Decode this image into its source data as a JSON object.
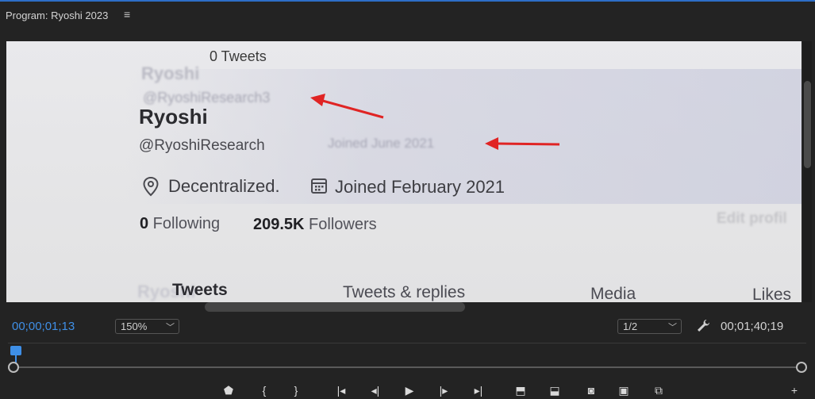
{
  "panel": {
    "title": "Program: Ryoshi 2023",
    "menu_icon": "hamburger-icon"
  },
  "video": {
    "tweets_count": "0 Tweets",
    "ghost_name": "Ryoshi",
    "ghost_handle": "@RyoshiResearch3",
    "name": "Ryoshi",
    "handle": "@RyoshiResearch",
    "ghost_joined": "Joined June 2021",
    "location": "Decentralized.",
    "joined": "Joined February 2021",
    "following_count": "0",
    "following_label": " Following",
    "followers_count": "209.5K",
    "followers_label": " Followers",
    "ghost_edit": "Edit profil",
    "ghost_name_bottom": "Ryoshi",
    "tabs": [
      "Tweets",
      "Tweets & replies",
      "Media",
      "Likes"
    ],
    "arrow_color": "#e02424"
  },
  "controls": {
    "current_timecode": "00;00;01;13",
    "zoom": "150%",
    "resolution": "1/2",
    "duration_timecode": "00;01;40;19",
    "settings_icon": "wrench-icon",
    "transport_buttons": [
      "add-marker-icon",
      "mark-in-icon",
      "mark-out-icon",
      "go-to-in-icon",
      "step-back-icon",
      "play-icon",
      "step-forward-icon",
      "go-to-out-icon",
      "lift-icon",
      "extract-icon",
      "export-frame-icon",
      "compare-view-icon",
      "vr-video-icon",
      "add-button-icon"
    ]
  },
  "accent_color": "#3e8fe7"
}
